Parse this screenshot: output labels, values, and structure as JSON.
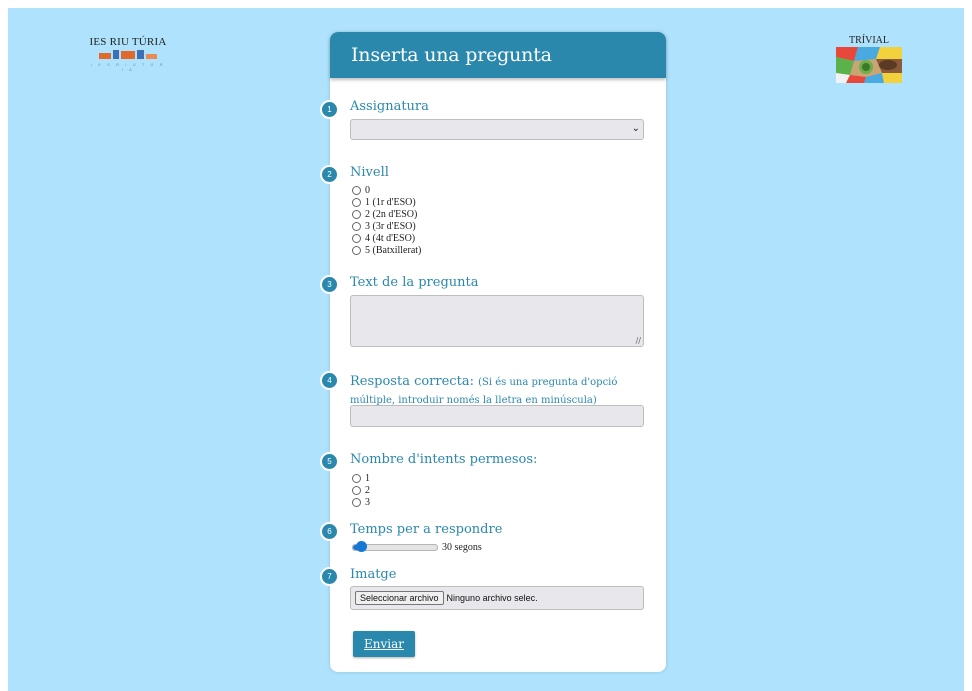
{
  "logos": {
    "left_title": "IES RIU TÚRIA",
    "left_subtitle": "I E S R I U T Ú R I A",
    "right_title": "TRÍVIAL"
  },
  "form": {
    "title": "Inserta una pregunta",
    "steps": [
      "1",
      "2",
      "3",
      "4",
      "5",
      "6",
      "7"
    ],
    "subject": {
      "label": "Assignatura",
      "selected": ""
    },
    "level": {
      "label": "Nivell",
      "options": [
        "0",
        "1 (1r d'ESO)",
        "2 (2n d'ESO)",
        "3 (3r d'ESO)",
        "4 (4t d'ESO)",
        "5 (Batxillerat)"
      ]
    },
    "question_text": {
      "label": "Text de la pregunta",
      "value": ""
    },
    "correct_answer": {
      "label": "Resposta correcta:",
      "hint": "(Si és una pregunta d'opció múltiple, introduir només la lletra en minúscula)",
      "value": ""
    },
    "attempts": {
      "label": "Nombre d'intents permesos:",
      "options": [
        "1",
        "2",
        "3"
      ]
    },
    "time": {
      "label": "Temps per a respondre",
      "value": 30,
      "min": 0,
      "max": 300,
      "value_text": "30 segons"
    },
    "image": {
      "label": "Imatge",
      "button_label": "Seleccionar archivo",
      "no_file_text": "Ninguno archivo selec."
    },
    "submit_label": "Enviar"
  },
  "colors": {
    "background": "#afe3fd",
    "accent": "#2a88ad",
    "field_bg": "#e8e8ec",
    "slider": "#1478d4"
  }
}
